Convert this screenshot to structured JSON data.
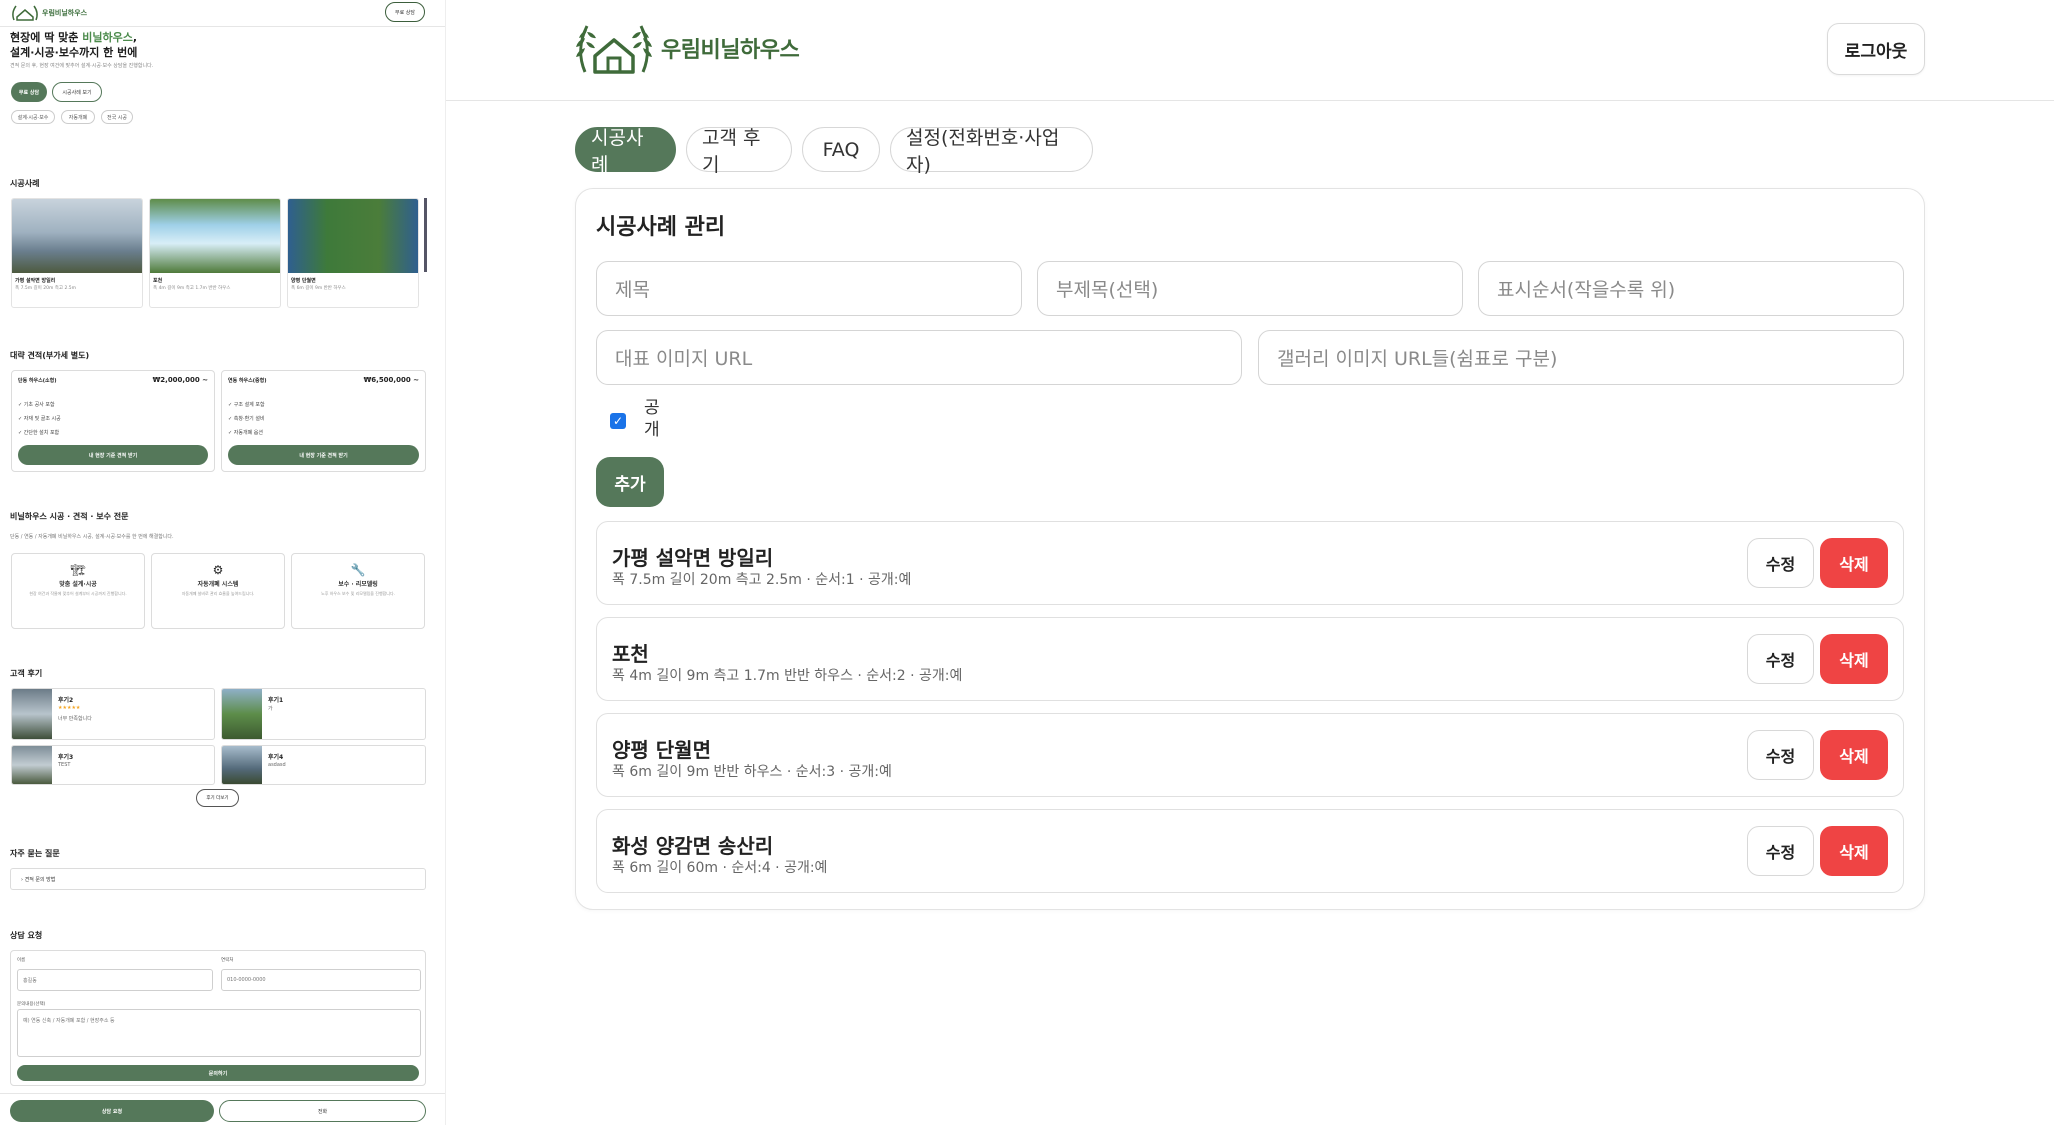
{
  "brand": {
    "name": "우림비닐하우스",
    "color": "#55785a"
  },
  "mobile": {
    "header": {
      "button": "무료 상담"
    },
    "hero": {
      "title_line1_prefix": "현장에 딱 맞춘 ",
      "title_line1_accent": "비닐하우스",
      "title_line1_suffix": ",",
      "title_line2": "설계·시공·보수까지 한 번에",
      "subtitle": "견적 문의 후, 현장 여건에 맞추어 설계·시공·보수 상담을 진행합니다.",
      "btn_primary": "무료 상담",
      "btn_secondary": "시공사례 보기",
      "chips": [
        "설계·시공·보수",
        "자동개폐",
        "전국 시공"
      ]
    },
    "cases": {
      "title": "시공사례",
      "items": [
        {
          "title": "가평 설악면 방일리",
          "sub": "폭 7.5m 길이 20m 측고 2.5m"
        },
        {
          "title": "포천",
          "sub": "폭 4m 길이 9m 측고 1.7m 반반 하우스"
        },
        {
          "title": "양평 단월면",
          "sub": "폭 6m 길이 9m 반반 하우스"
        }
      ]
    },
    "pricing": {
      "title": "대략 견적(부가세 별도)",
      "cards": [
        {
          "name": "단동 하우스(소형)",
          "amount": "₩2,000,000 ~",
          "lines": [
            "✓ 기초 공사 포함",
            "✓ 자재 및 골조 시공",
            "✓ 간단한 설치 포함"
          ],
          "button": "내 현장 기준 견적 받기"
        },
        {
          "name": "연동 하우스(중형)",
          "amount": "₩6,500,000 ~",
          "lines": [
            "✓ 구조 설계 포함",
            "✓ 측창·환기 설비",
            "✓ 자동개폐 옵션"
          ],
          "button": "내 현장 기준 견적 받기"
        }
      ]
    },
    "about": {
      "title": "비닐하우스 시공 · 견적 · 보수 전문",
      "desc": "단동 / 연동 / 자동개폐 비닐하우스 시공, 설계·시공·보수를 한 번에 해결합니다.",
      "features": [
        {
          "icon": "🏗",
          "title": "맞춤 설계·시공",
          "desc": "현장 여건과 작물에 맞추어 설계부터 시공까지 진행합니다."
        },
        {
          "icon": "⚙",
          "title": "자동개폐 시스템",
          "desc": "자동개폐 설비로 관리 효율을 높여드립니다."
        },
        {
          "icon": "🔧",
          "title": "보수 · 리모델링",
          "desc": "노후 하우스 보수 및 리모델링을 진행합니다."
        }
      ]
    },
    "reviews": {
      "title": "고객 후기",
      "items": [
        {
          "title": "후기2",
          "stars": "★★★★★",
          "text": "너무 만족합니다"
        },
        {
          "title": "후기1",
          "stars": "",
          "text": "가"
        },
        {
          "title": "후기3",
          "stars": "",
          "text": "TEST"
        },
        {
          "title": "후기4",
          "stars": "",
          "text": "asdasd"
        }
      ],
      "more": "후기 더보기"
    },
    "faq": {
      "title": "자주 묻는 질문",
      "item": "› 견적 문의 방법"
    },
    "form": {
      "title": "상담 요청",
      "name_label": "이름",
      "name_placeholder": "홍길동",
      "phone_label": "연락처",
      "phone_placeholder": "010-0000-0000",
      "msg_label": "문의내용(선택)",
      "msg_placeholder": "예) 연동 신축 / 자동개폐 포함 / 현장주소 등",
      "submit": "문의하기"
    },
    "bottom": {
      "primary": "상담 요청",
      "secondary": "전화"
    }
  },
  "admin": {
    "header": {
      "logout": "로그아웃"
    },
    "tabs": [
      {
        "label": "시공사례",
        "active": true
      },
      {
        "label": "고객 후기",
        "active": false
      },
      {
        "label": "FAQ",
        "active": false
      },
      {
        "label": "설정(전화번호·사업자)",
        "active": false
      }
    ],
    "panel": {
      "title": "시공사례 관리",
      "fields": {
        "title_placeholder": "제목",
        "subtitle_placeholder": "부제목(선택)",
        "order_placeholder": "표시순서(작을수록 위)",
        "image_placeholder": "대표 이미지 URL",
        "gallery_placeholder": "갤러리 이미지 URL들(쉼표로 구분)"
      },
      "public_label": "공개",
      "public_checked": true,
      "add_button": "추가",
      "edit_label": "수정",
      "delete_label": "삭제",
      "delete_color": "#ef4444",
      "items": [
        {
          "title": "가평 설악면 방일리",
          "meta": "폭 7.5m 길이 20m 측고 2.5m · 순서:1 · 공개:예"
        },
        {
          "title": "포천",
          "meta": "폭 4m 길이 9m 측고 1.7m 반반 하우스 · 순서:2 · 공개:예"
        },
        {
          "title": "양평 단월면",
          "meta": "폭 6m 길이 9m 반반 하우스 · 순서:3 · 공개:예"
        },
        {
          "title": "화성 양감면 송산리",
          "meta": "폭 6m 길이 60m · 순서:4 · 공개:예"
        }
      ]
    }
  }
}
